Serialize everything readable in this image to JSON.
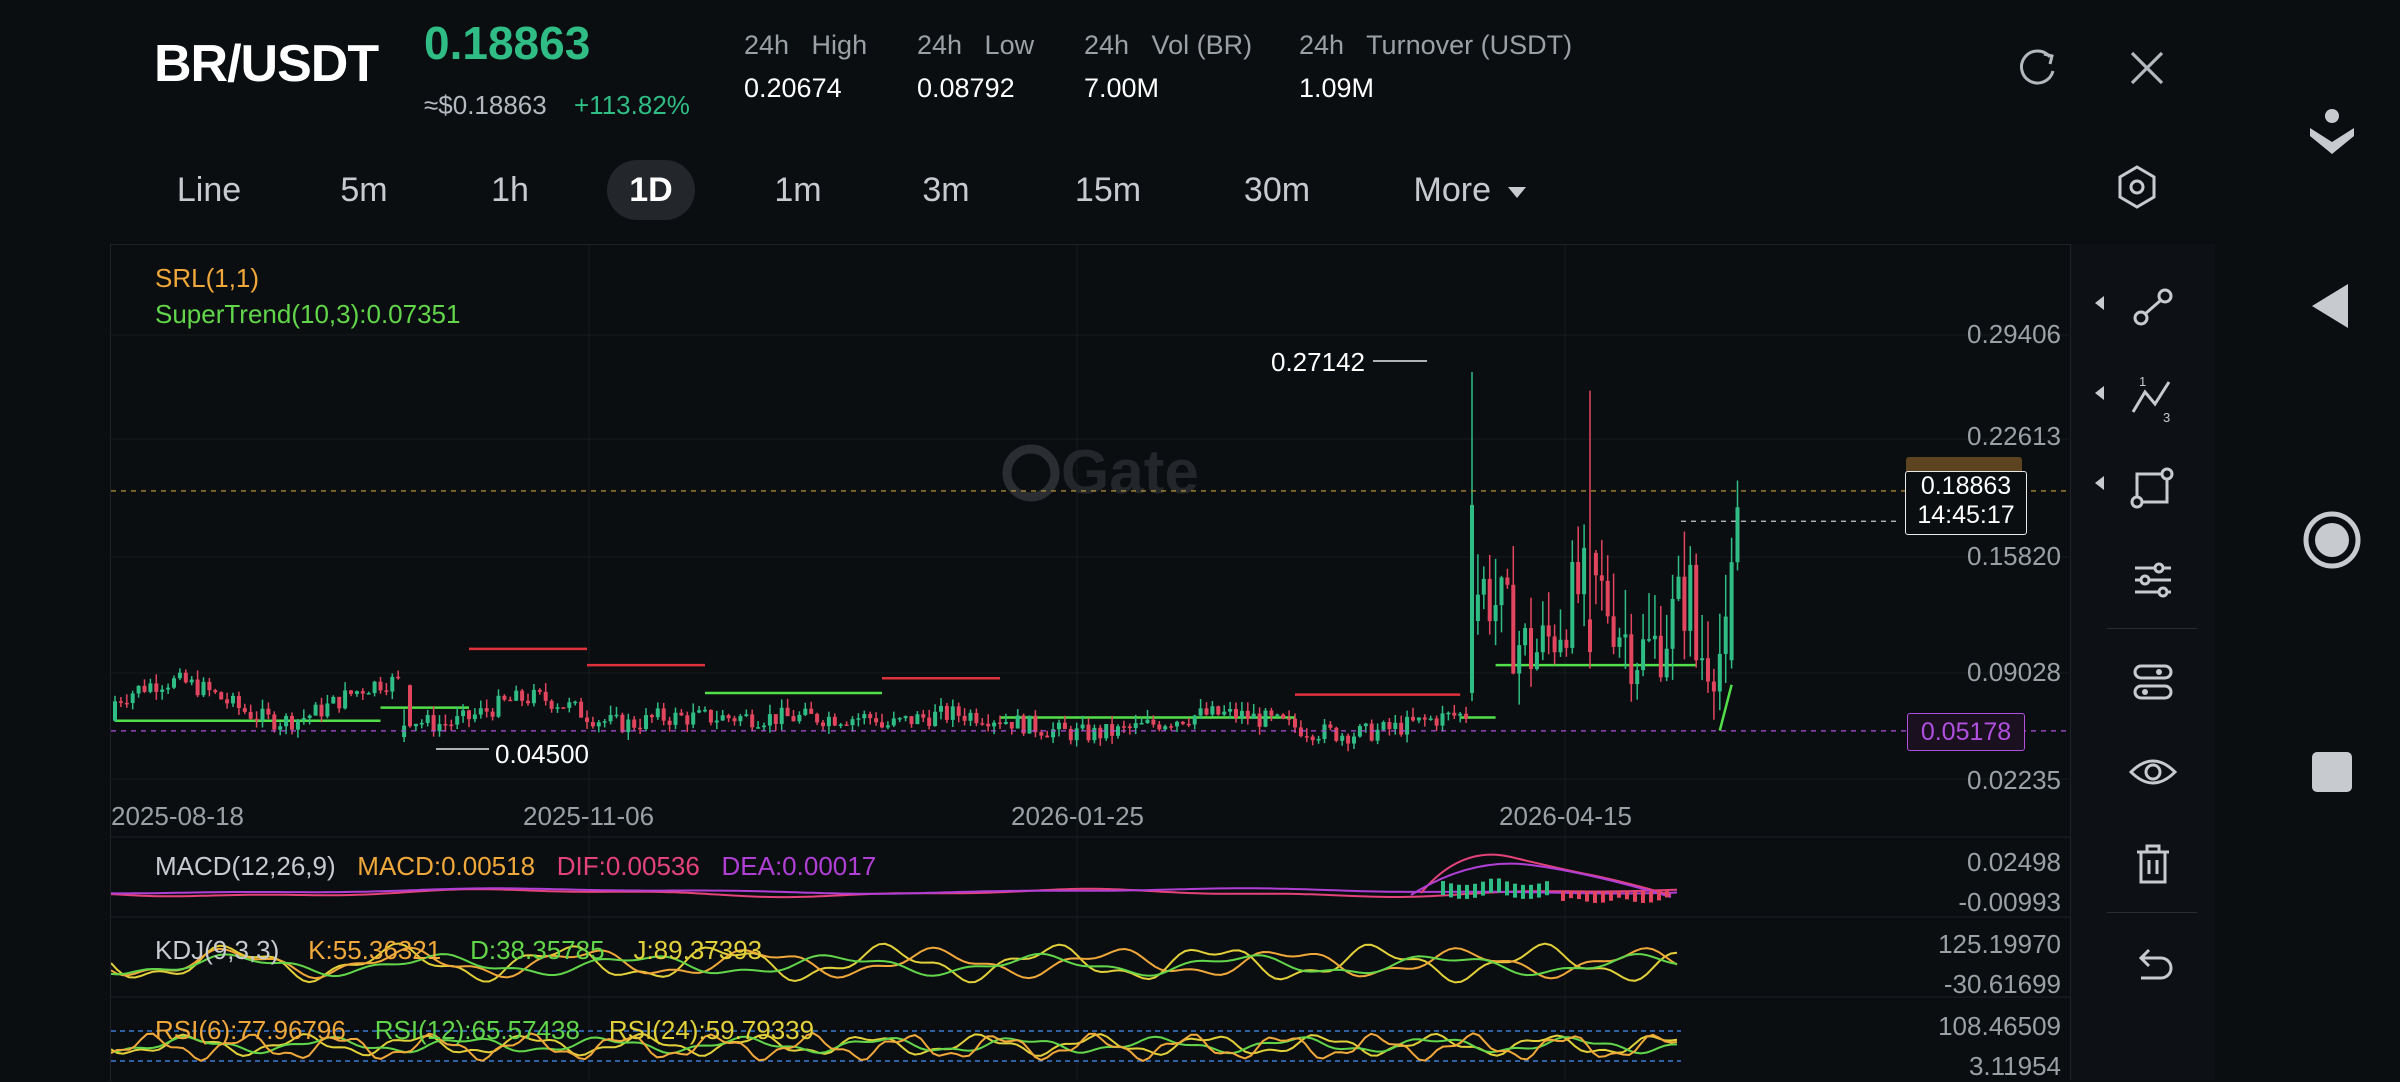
{
  "header": {
    "pair": "BR/USDT",
    "price": "0.18863",
    "fiat_price": "≈$0.18863",
    "change": "+113.82%",
    "stats": [
      {
        "label": "24h   High",
        "value": "0.20674"
      },
      {
        "label": "24h   Low",
        "value": "0.08792"
      },
      {
        "label": "24h   Vol (BR)",
        "value": "7.00M"
      },
      {
        "label": "24h   Turnover (USDT)",
        "value": "1.09M"
      }
    ]
  },
  "timeframes": [
    "Line",
    "5m",
    "1h",
    "1D",
    "1m",
    "3m",
    "15m",
    "30m"
  ],
  "timeframe_active": "1D",
  "more_label": "More",
  "chart": {
    "watermark": "Gate",
    "indicators": {
      "srl": "SRL(1,1)",
      "supertrend": "SuperTrend(10,3):0.07351"
    },
    "y_labels": [
      "0.29406",
      "0.22613",
      "0.15820",
      "0.09028",
      "0.02235"
    ],
    "x_labels": [
      "2025-08-18",
      "2025-11-06",
      "2026-01-25",
      "2026-04-15"
    ],
    "current_price_tag": "0.18863",
    "countdown": "14:45:17",
    "purple_tag": "0.05178",
    "high_marker": "0.27142",
    "low_marker": "0.04500",
    "macd": {
      "label": "MACD(12,26,9)",
      "macd": "MACD:0.00518",
      "dif": "DIF:0.00536",
      "dea": "DEA:0.00017",
      "y_top": "0.02498",
      "y_bottom": "-0.00993"
    },
    "kdj": {
      "label": "KDJ(9,3,3)",
      "k": "K:55.36321",
      "d": "D:38.35785",
      "j": "J:89.37393",
      "y_top": "125.19970",
      "y_bottom": "-30.61699"
    },
    "rsi": {
      "label": "RSI(6):77.96796",
      "rsi12": "RSI(12):65.57438",
      "rsi24": "RSI(24):59.79339",
      "y_top": "108.46509",
      "y_bottom": "3.11954"
    }
  },
  "colors": {
    "up": "#2fbd85",
    "down": "#e2465e",
    "supertrend_up": "#52e04a",
    "supertrend_down": "#e0323c",
    "srl": "#f0a83a",
    "macd": "#f0a83a",
    "dif": "#e4437a",
    "dea": "#b03fd6",
    "kdj_k": "#f0a83a",
    "kdj_d": "#62d64a",
    "kdj_j": "#e2d03a",
    "purple": "#b04fe0"
  },
  "toolbar": [
    "line-draw-icon",
    "fib-icon",
    "shape-icon",
    "indicator-settings-icon",
    "layer-settings-icon",
    "eye-icon",
    "trash-icon",
    "undo-icon"
  ],
  "chart_data": {
    "type": "candlestick",
    "x": [
      "2025-08-18",
      "2025-11-06",
      "2026-01-25",
      "2026-04-15"
    ],
    "ylim": [
      0.02235,
      0.29406
    ],
    "yticks": [
      0.29406,
      0.22613,
      0.1582,
      0.09028,
      0.02235
    ],
    "high": 0.27142,
    "low": 0.045,
    "last": 0.18863,
    "supertrend": 0.07351
  }
}
